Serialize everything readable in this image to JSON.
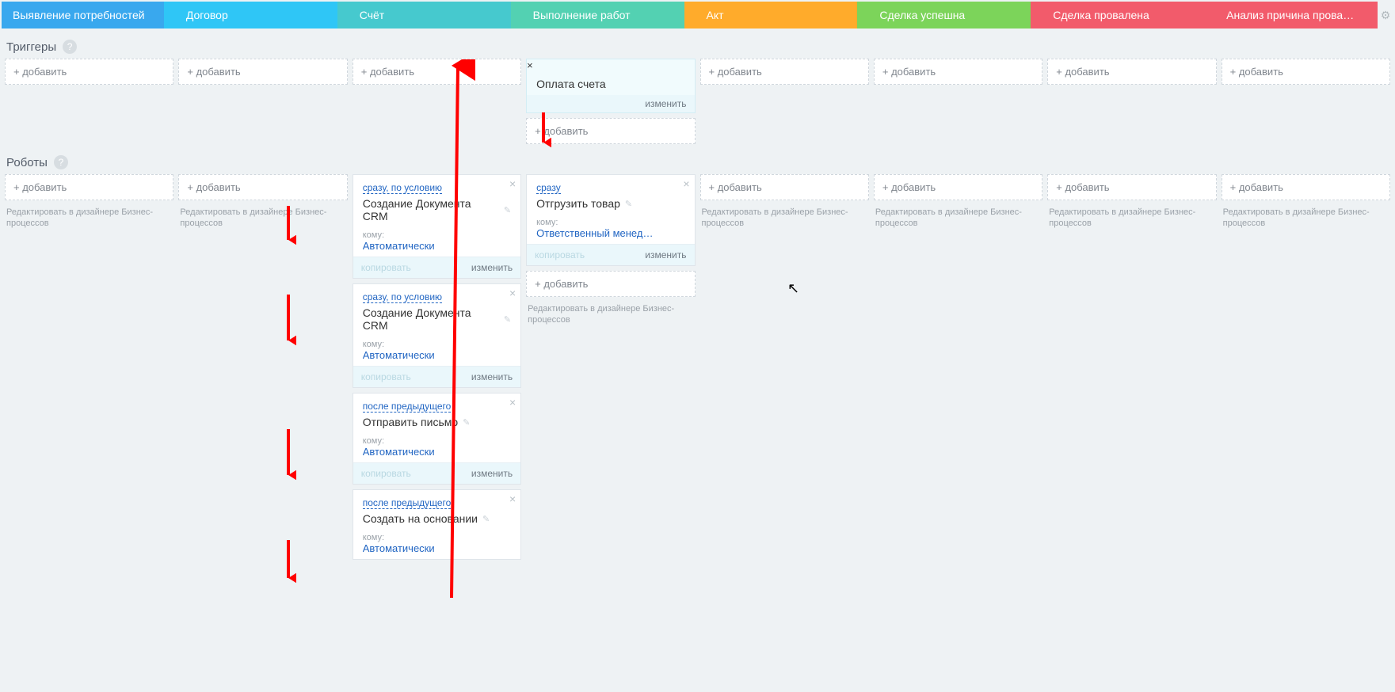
{
  "stages": [
    {
      "label": "Выявление потребностей",
      "color": "#39a8ee"
    },
    {
      "label": "Договор",
      "color": "#2fc6f6"
    },
    {
      "label": "Счёт",
      "color": "#46c9ce"
    },
    {
      "label": "Выполнение работ",
      "color": "#53d1b2"
    },
    {
      "label": "Акт",
      "color": "#ffab2b"
    },
    {
      "label": "Сделка успешна",
      "color": "#7cd45a"
    },
    {
      "label": "Сделка провалена",
      "color": "#f25b6b"
    },
    {
      "label": "Анализ причина прова…",
      "color": "#f25b6b"
    }
  ],
  "sections": {
    "triggers": "Триггеры",
    "robots": "Роботы"
  },
  "labels": {
    "add": "+ добавить",
    "bp_editor": "Редактировать в дизайнере Бизнес-процессов",
    "copy": "копировать",
    "edit": "изменить",
    "kom": "кому:"
  },
  "triggers": {
    "col3": {
      "title": "Оплата счета"
    }
  },
  "robots": {
    "col2": [
      {
        "timing": "сразу, по условию",
        "title": "Создание Документа CRM",
        "assignee": "Автоматически"
      },
      {
        "timing": "сразу, по условию",
        "title": "Создание Документа CRM",
        "assignee": "Автоматически"
      },
      {
        "timing": "после предыдущего",
        "title": "Отправить письмо",
        "assignee": "Автоматически"
      },
      {
        "timing": "после предыдущего",
        "title": "Создать на основании",
        "assignee": "Автоматически"
      }
    ],
    "col3": [
      {
        "timing": "сразу",
        "title": "Отгрузить товар",
        "assignee": "Ответственный менед…"
      }
    ]
  }
}
